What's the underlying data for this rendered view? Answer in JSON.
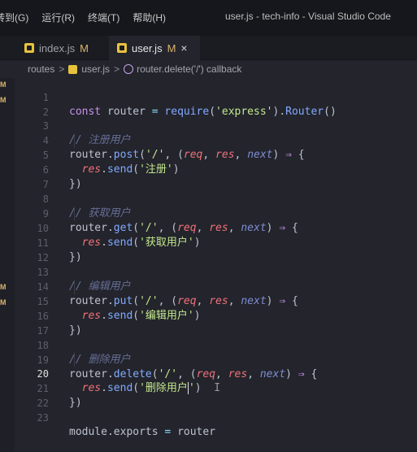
{
  "titlebar": {
    "menu": [
      "转到(G)",
      "运行(R)",
      "终端(T)",
      "帮助(H)"
    ],
    "title": "user.js - tech-info - Visual Studio Code"
  },
  "tabs": [
    {
      "label": "index.js",
      "modified": "M",
      "active": false
    },
    {
      "label": "user.js",
      "modified": "M",
      "active": true,
      "close": "×"
    }
  ],
  "breadcrumb": {
    "folder": "routes",
    "file": "user.js",
    "symbol": "router.delete('/') callback"
  },
  "left_badges": [
    "M",
    "M",
    "M",
    "M"
  ],
  "editor": {
    "current_line": "20",
    "lines": [
      {
        "n": "1"
      },
      {
        "n": "2"
      },
      {
        "n": "3"
      },
      {
        "n": "4"
      },
      {
        "n": "5"
      },
      {
        "n": "6"
      },
      {
        "n": "7"
      },
      {
        "n": "8"
      },
      {
        "n": "9"
      },
      {
        "n": "10"
      },
      {
        "n": "11"
      },
      {
        "n": "12"
      },
      {
        "n": "13"
      },
      {
        "n": "14"
      },
      {
        "n": "15"
      },
      {
        "n": "16"
      },
      {
        "n": "17"
      },
      {
        "n": "18"
      },
      {
        "n": "19"
      },
      {
        "n": "20"
      },
      {
        "n": "21"
      },
      {
        "n": "22"
      },
      {
        "n": "23"
      }
    ],
    "text": {
      "const": "const",
      "router": "router",
      "eq": "=",
      "require": "require",
      "express": "'express'",
      "Router": "Router",
      "c_register": "// 注册用户",
      "c_get": "// 获取用户",
      "c_edit": "// 编辑用户",
      "c_delete": "// 删除用户",
      "post": "post",
      "get": "get",
      "put": "put",
      "delete": "delete",
      "slash": "'/'",
      "req": "req",
      "res": "res",
      "next": "next",
      "arrow": "⇒",
      "send": "send",
      "s_register": "'注册'",
      "s_get": "'获取用户'",
      "s_edit": "'编辑用户'",
      "s_delete_open": "'删除用户",
      "s_delete_close": "'",
      "module": "module",
      "exports": "exports"
    }
  }
}
